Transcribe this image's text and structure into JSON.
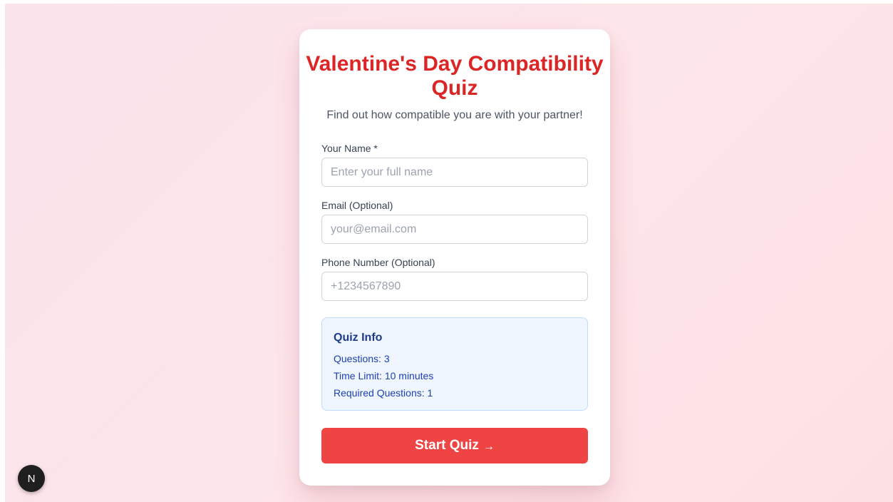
{
  "quiz": {
    "title": "Valentine's Day Compatibility Quiz",
    "subtitle": "Find out how compatible you are with your partner!",
    "fields": {
      "name": {
        "label": "Your Name *",
        "placeholder": "Enter your full name",
        "value": ""
      },
      "email": {
        "label": "Email (Optional)",
        "placeholder": "your@email.com",
        "value": ""
      },
      "phone": {
        "label": "Phone Number (Optional)",
        "placeholder": "+1234567890",
        "value": ""
      }
    },
    "info": {
      "title": "Quiz Info",
      "questions": "Questions: 3",
      "time_limit": "Time Limit: 10 minutes",
      "required": "Required Questions: 1"
    },
    "start_label": "Start Quiz",
    "start_arrow": "→"
  },
  "dev_badge": {
    "letter": "N",
    "icon": "nextjs-logo-icon"
  },
  "colors": {
    "accent": "#ef4444",
    "title": "#dc2626",
    "info_bg": "#eff6ff",
    "info_text": "#1e40af"
  }
}
